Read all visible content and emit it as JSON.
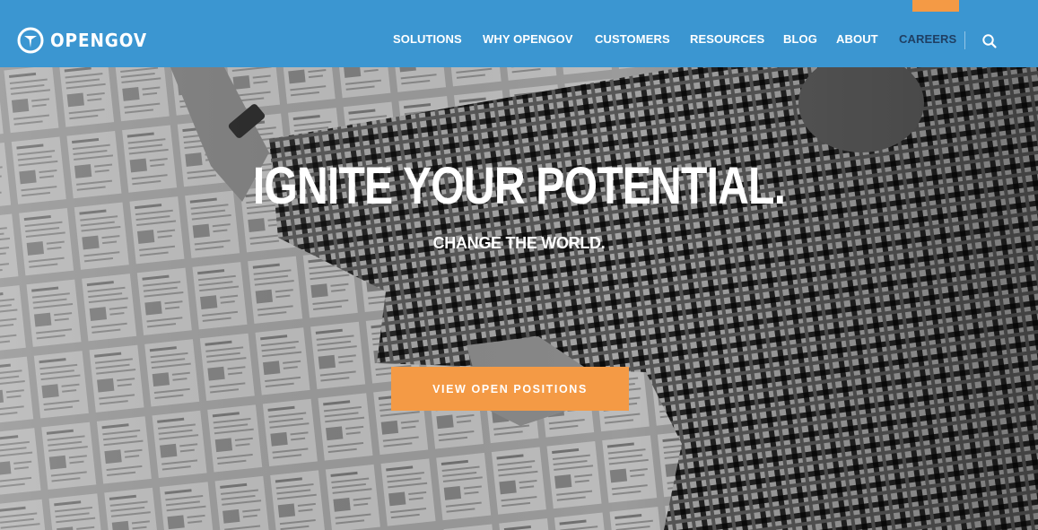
{
  "header": {
    "brand": "OPENGOV",
    "top_utility_text": "",
    "nav": [
      {
        "label": "SOLUTIONS"
      },
      {
        "label": "WHY OPENGOV"
      },
      {
        "label": "CUSTOMERS"
      },
      {
        "label": "RESOURCES"
      },
      {
        "label": "BLOG"
      },
      {
        "label": "ABOUT"
      },
      {
        "label": "CAREERS",
        "active": true
      }
    ],
    "search_icon": "search-icon"
  },
  "hero": {
    "title": "IGNITE YOUR POTENTIAL.",
    "subtitle": "CHANGE THE WORLD.",
    "cta_label": "VIEW OPEN POSITIONS"
  },
  "colors": {
    "header_bg": "#3b96d1",
    "accent_orange": "#f49a45",
    "active_nav": "#1f3f63",
    "text_white": "#ffffff"
  }
}
